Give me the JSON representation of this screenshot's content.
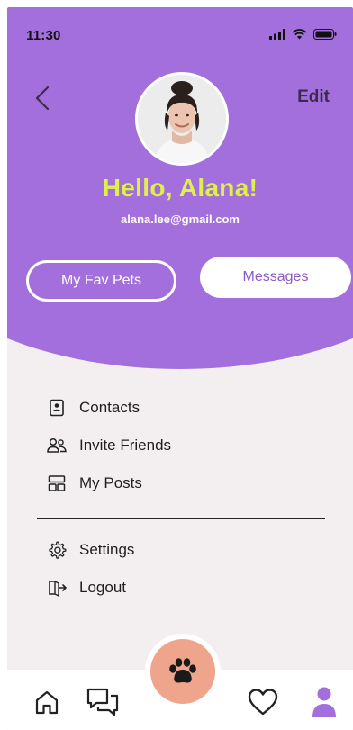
{
  "status_bar": {
    "time": "11:30",
    "icons": [
      "signal-icon",
      "wifi-icon",
      "battery-icon"
    ]
  },
  "header": {
    "back_icon": "chevron-left-icon",
    "edit_label": "Edit",
    "greeting": "Hello, Alana!",
    "email": "alana.lee@gmail.com"
  },
  "actions": {
    "fav_pets_label": "My Fav Pets",
    "messages_label": "Messages"
  },
  "menu": {
    "items": [
      {
        "label": "Contacts",
        "icon": "contacts-icon"
      },
      {
        "label": "Invite Friends",
        "icon": "users-icon"
      },
      {
        "label": "My Posts",
        "icon": "layout-icon"
      }
    ],
    "secondary": [
      {
        "label": "Settings",
        "icon": "gear-icon"
      },
      {
        "label": "Logout",
        "icon": "logout-icon"
      }
    ]
  },
  "tabbar": {
    "tabs": [
      "home-icon",
      "chat-icon",
      "paw-icon",
      "heart-icon",
      "profile-icon"
    ],
    "active": "profile-icon"
  },
  "colors": {
    "accent": "#a36fdd",
    "greeting": "#dff04a",
    "fab": "#eea58c",
    "background": "#f3eff1"
  }
}
